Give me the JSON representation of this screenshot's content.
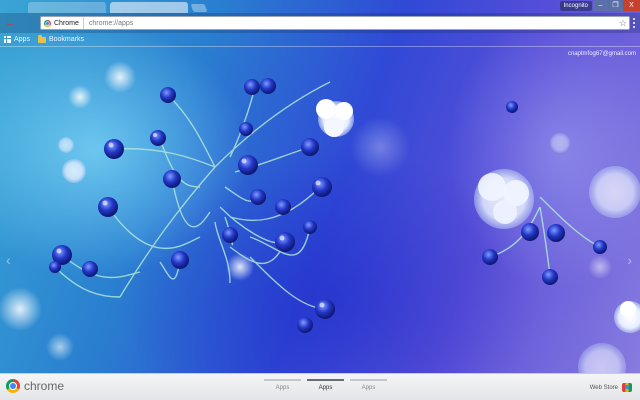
{
  "window": {
    "user_label": "Incognito",
    "minimize_glyph": "–",
    "maximize_glyph": "❐",
    "close_glyph": "X"
  },
  "toolbar": {
    "back_glyph": "←",
    "omnibox": {
      "chip_label": "Chrome",
      "url": "chrome://apps",
      "star_glyph": "☆"
    }
  },
  "bookmarks": [
    {
      "label": "Apps",
      "icon": "apps-grid-icon"
    },
    {
      "label": "Bookmarks",
      "icon": "folder-icon"
    }
  ],
  "account": {
    "email": "cnaptmfog67@gmail.com"
  },
  "wallpaper": {
    "left_arrow_glyph": "‹",
    "right_arrow_glyph": "›",
    "accent_colors": [
      "#3aa6d4",
      "#3049d6",
      "#8a7ee0",
      "#2535b8",
      "#ffffff"
    ]
  },
  "bottombar": {
    "brand": "chrome",
    "pages": [
      {
        "label": "Apps",
        "active": false
      },
      {
        "label": "Apps",
        "active": true
      },
      {
        "label": "Apps",
        "active": false
      }
    ],
    "webstore_label": "Web Store"
  }
}
